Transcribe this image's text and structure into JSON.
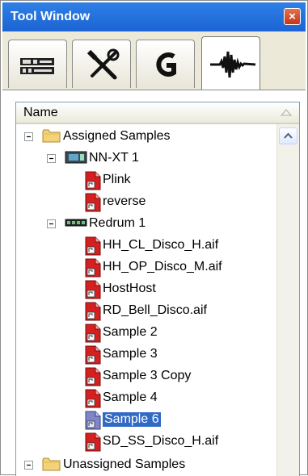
{
  "window": {
    "title": "Tool Window",
    "close_glyph": "×"
  },
  "tabs": [
    {
      "name": "device-rack-icon"
    },
    {
      "name": "tools-icon"
    },
    {
      "name": "groove-icon"
    },
    {
      "name": "waveform-icon"
    }
  ],
  "tree": {
    "column_header": "Name",
    "nodes": [
      {
        "label": "Assigned Samples",
        "icon": "folder-icon",
        "expander": "−"
      },
      {
        "label": "NN-XT 1",
        "icon": "nnxt-device-icon",
        "expander": "−"
      },
      {
        "label": "Plink",
        "icon": "sample-file-icon"
      },
      {
        "label": "reverse",
        "icon": "sample-file-icon"
      },
      {
        "label": "Redrum 1",
        "icon": "redrum-device-icon",
        "expander": "−"
      },
      {
        "label": "HH_CL_Disco_H.aif",
        "icon": "sample-file-icon"
      },
      {
        "label": "HH_OP_Disco_M.aif",
        "icon": "sample-file-icon"
      },
      {
        "label": "HostHost",
        "icon": "sample-file-icon"
      },
      {
        "label": "RD_Bell_Disco.aif",
        "icon": "sample-file-icon"
      },
      {
        "label": "Sample 2",
        "icon": "sample-file-icon"
      },
      {
        "label": "Sample 3",
        "icon": "sample-file-icon"
      },
      {
        "label": "Sample 3 Copy",
        "icon": "sample-file-icon"
      },
      {
        "label": "Sample 4",
        "icon": "sample-file-icon"
      },
      {
        "label": "Sample 6",
        "icon": "sample-file-icon",
        "selected": true
      },
      {
        "label": "SD_SS_Disco_H.aif",
        "icon": "sample-file-icon"
      },
      {
        "label": "Unassigned Samples",
        "icon": "folder-icon",
        "expander": "−"
      }
    ]
  },
  "colors": {
    "title_bar": "#1c64d4",
    "selection": "#316ac5",
    "sample_icon_red": "#d42020",
    "folder": "#f3d27a"
  }
}
